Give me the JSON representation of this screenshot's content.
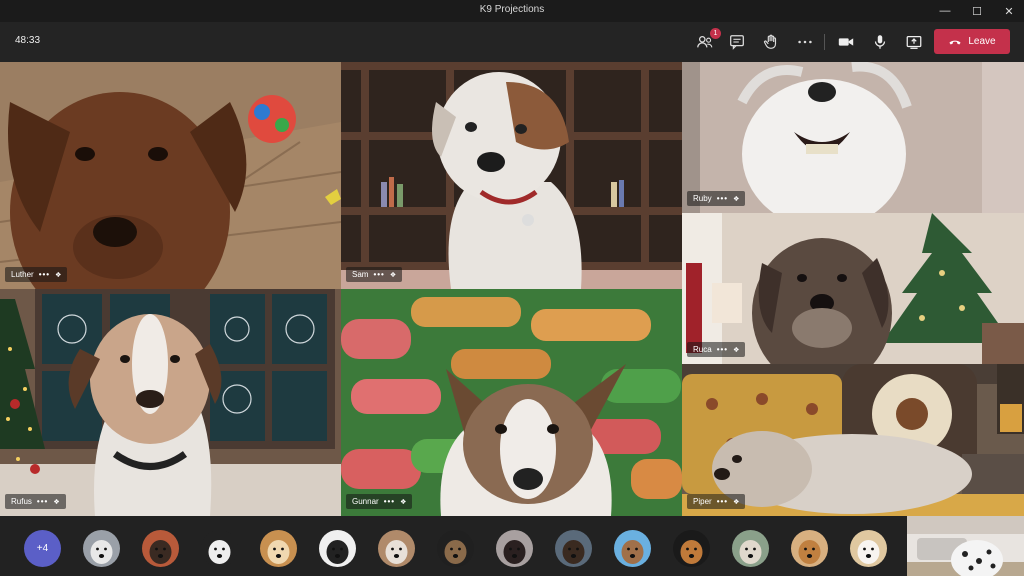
{
  "window": {
    "title": "K9 Projections",
    "controls": [
      "minimize-icon",
      "maximize-icon",
      "close-icon"
    ]
  },
  "toolbar": {
    "timer": "48:33",
    "participants_badge": "1",
    "leave_label": "Leave",
    "icons": [
      "participants-icon",
      "chat-icon",
      "raise-hand-icon",
      "more-options-icon",
      "camera-icon",
      "microphone-icon",
      "share-screen-icon",
      "phone-hangup-icon"
    ]
  },
  "participants": [
    {
      "name": "Luther",
      "dots": "•••"
    },
    {
      "name": "Sam",
      "dots": "•••"
    },
    {
      "name": "Ruby",
      "dots": "•••"
    },
    {
      "name": "Ruca",
      "dots": "•••"
    },
    {
      "name": "Rufus",
      "dots": "•••"
    },
    {
      "name": "Gunnar",
      "dots": "•••"
    },
    {
      "name": "Piper",
      "dots": "•••"
    }
  ],
  "strip": {
    "overflow_label": "+4",
    "avatar_count_label": "14"
  },
  "colors": {
    "leave": "#c4314b",
    "overflow_avatar": "#5b5fc7",
    "badge": "#c4314b"
  }
}
